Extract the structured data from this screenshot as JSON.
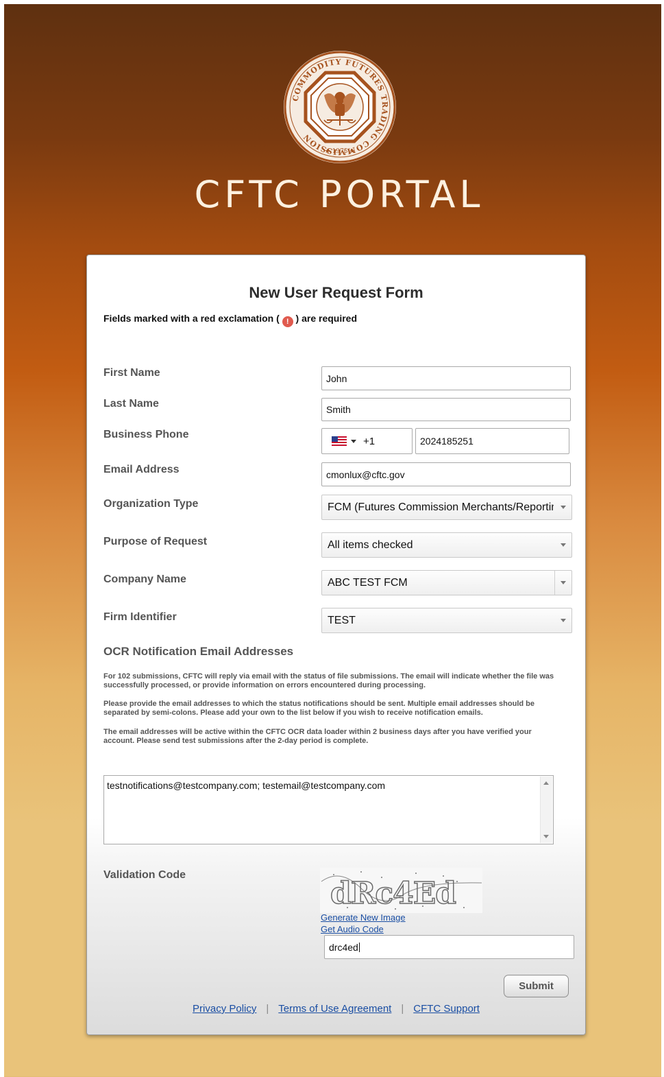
{
  "header": {
    "seal_top_text": "COMMODITY FUTURES TRADING COMMISSION",
    "seal_year": "1975",
    "portal_title": "CFTC PORTAL"
  },
  "form": {
    "title": "New User Request Form",
    "required_note_prefix": "Fields marked with a red exclamation (",
    "required_note_suffix": ") are required",
    "required_icon": "!",
    "fields": {
      "first_name": {
        "label": "First Name",
        "value": "John"
      },
      "last_name": {
        "label": "Last Name",
        "value": "Smith"
      },
      "business_phone": {
        "label": "Business Phone",
        "country_code": "+1",
        "number": "2024185251",
        "flag_icon": "us-flag-icon"
      },
      "email": {
        "label": "Email Address",
        "value": "cmonlux@cftc.gov"
      },
      "org_type": {
        "label": "Organization Type",
        "value": "FCM (Futures Commission Merchants/Reportin"
      },
      "purpose": {
        "label": "Purpose of Request",
        "value": "All items checked"
      },
      "company": {
        "label": "Company Name",
        "value": "ABC TEST FCM"
      },
      "firm_id": {
        "label": "Firm Identifier",
        "value": "TEST"
      }
    },
    "ocr": {
      "title": "OCR Notification Email Addresses",
      "para1": "For 102 submissions, CFTC will reply via email with the status of file submissions. The email will indicate whether the file was successfully processed, or provide information on errors encountered during processing.",
      "para2": "Please provide the email addresses to which the status notifications should be sent. Multiple email addresses should be separated by semi-colons. Please add your own to the list below if you wish to receive notification emails.",
      "para3": "The email addresses will be active within the CFTC OCR data loader within 2 business days after you have verified your account. Please send test submissions after the 2-day period is complete.",
      "emails_value": "testnotifications@testcompany.com; testemail@testcompany.com"
    },
    "validation": {
      "label": "Validation Code",
      "captcha_text": "dRc4Ed",
      "generate_link": "Generate New Image",
      "audio_link": "Get Audio Code",
      "value": "drc4ed"
    },
    "submit_label": "Submit"
  },
  "footer": {
    "privacy": "Privacy Policy",
    "terms": "Terms of Use Agreement",
    "support": "CFTC Support",
    "separator": "|"
  },
  "colors": {
    "accent_link": "#1a4ea3",
    "seal": "#a6521e",
    "required_icon": "#e05a4e"
  }
}
